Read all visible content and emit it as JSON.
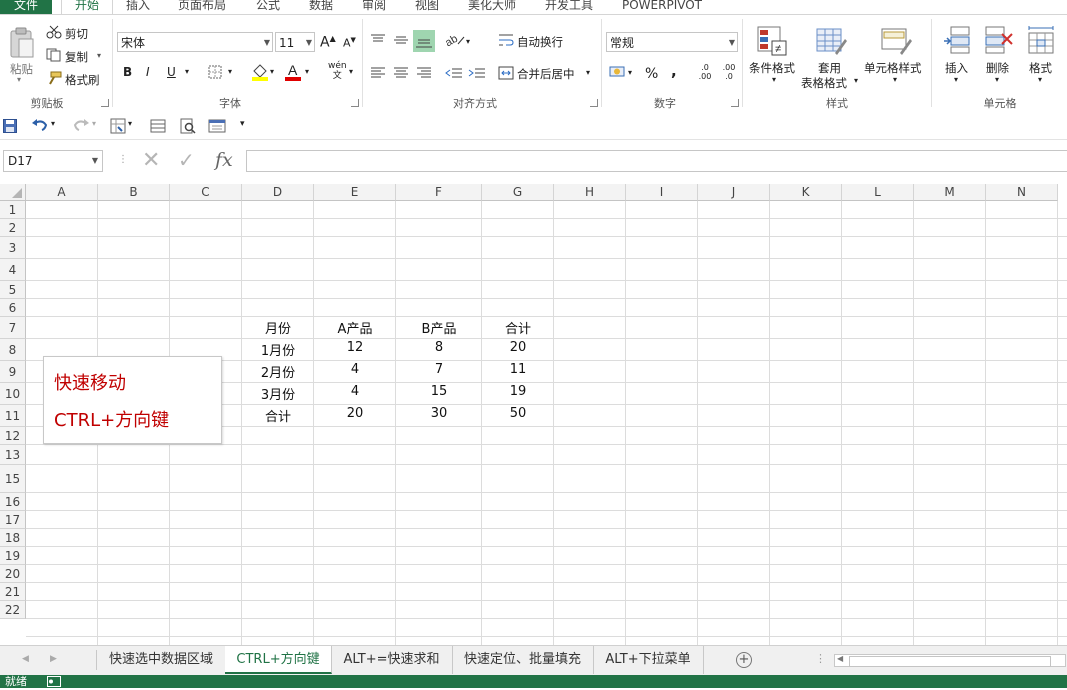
{
  "tabs": [
    {
      "label": "文件"
    },
    {
      "label": "开始"
    },
    {
      "label": "插入"
    },
    {
      "label": "页面布局"
    },
    {
      "label": "公式"
    },
    {
      "label": "数据"
    },
    {
      "label": "审阅"
    },
    {
      "label": "视图"
    },
    {
      "label": "美化大师"
    },
    {
      "label": "开发工具"
    },
    {
      "label": "POWERPIVOT"
    }
  ],
  "ribbon": {
    "clipboard": {
      "paste": "粘贴",
      "cut": "剪切",
      "copy": "复制",
      "format_painter": "格式刷",
      "group": "剪贴板"
    },
    "font": {
      "name": "宋体",
      "size": "11",
      "bold": "B",
      "italic": "I",
      "underline": "U",
      "grow": "A",
      "shrink": "A",
      "color_a": "A",
      "phonetic": "wén",
      "group": "字体"
    },
    "alignment": {
      "wrap": "自动换行",
      "merge": "合并后居中",
      "group": "对齐方式"
    },
    "number": {
      "format": "常规",
      "percent": "%",
      "comma": ",",
      "inc_dec": ".0 .00",
      "dec_dec": ".00 .0",
      "group": "数字"
    },
    "styles": {
      "conditional": "条件格式",
      "table_line1": "套用",
      "table_line2": "表格格式",
      "cell_styles": "单元格样式",
      "group": "样式"
    },
    "cells": {
      "insert": "插入",
      "delete": "删除",
      "format": "格式",
      "group": "单元格"
    }
  },
  "namebox": {
    "value": "D17"
  },
  "formula": {
    "fx": "fx",
    "value": ""
  },
  "columns": [
    "A",
    "B",
    "C",
    "D",
    "E",
    "F",
    "G",
    "H",
    "I",
    "J",
    "K",
    "L",
    "M",
    "N"
  ],
  "rows": [
    "1",
    "2",
    "3",
    "4",
    "5",
    "6",
    "7",
    "8",
    "9",
    "10",
    "11",
    "12",
    "13",
    "15",
    "16",
    "17",
    "18",
    "19",
    "20",
    "21",
    "22"
  ],
  "table": {
    "header": [
      "月份",
      "A产品",
      "B产品",
      "合计"
    ],
    "rows": [
      [
        "1月份",
        "12",
        "8",
        "20"
      ],
      [
        "2月份",
        "4",
        "7",
        "11"
      ],
      [
        "3月份",
        "4",
        "15",
        "19"
      ],
      [
        "合计",
        "20",
        "30",
        "50"
      ]
    ]
  },
  "textbox": {
    "line1": "快速移动",
    "line2": "CTRL+方向键"
  },
  "sheets": [
    {
      "label": "快速选中数据区域"
    },
    {
      "label": "CTRL+方向键"
    },
    {
      "label": "ALT+=快速求和"
    },
    {
      "label": "快速定位、批量填充"
    },
    {
      "label": "ALT+下拉菜单"
    }
  ],
  "status": {
    "text": "就绪"
  },
  "colors": {
    "accent": "#217346",
    "textbox_text": "#c00000"
  }
}
